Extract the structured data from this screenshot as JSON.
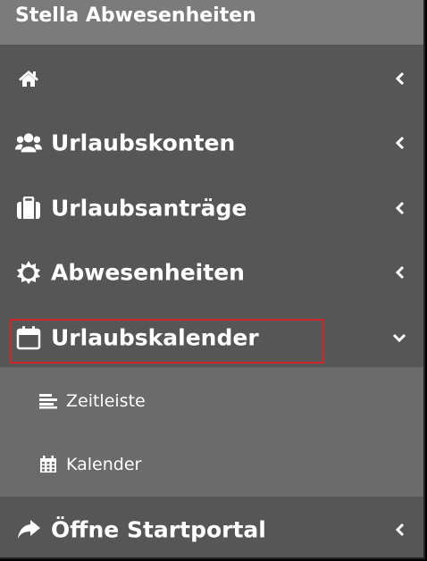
{
  "header": {
    "title": "Stella Abwesenheiten"
  },
  "menu": [
    {
      "label": "",
      "icon": "home-icon"
    },
    {
      "label": "Urlaubskonten",
      "icon": "users-icon"
    },
    {
      "label": "Urlaubsanträge",
      "icon": "suitcase-icon"
    },
    {
      "label": "Abwesenheiten",
      "icon": "sun-icon"
    },
    {
      "label": "Urlaubskalender",
      "icon": "calendar-icon",
      "expanded": true
    },
    {
      "label": "Öffne Startportal",
      "icon": "share-arrow-icon"
    }
  ],
  "submenu": [
    {
      "label": "Zeitleiste",
      "icon": "timeline-icon"
    },
    {
      "label": "Kalender",
      "icon": "calendar-grid-icon"
    }
  ],
  "colors": {
    "sidebar_bg": "#565656",
    "header_bg": "#7b7b7b",
    "submenu_bg": "#6b6b6b",
    "highlight": "#d0252b",
    "text": "#ffffff"
  }
}
